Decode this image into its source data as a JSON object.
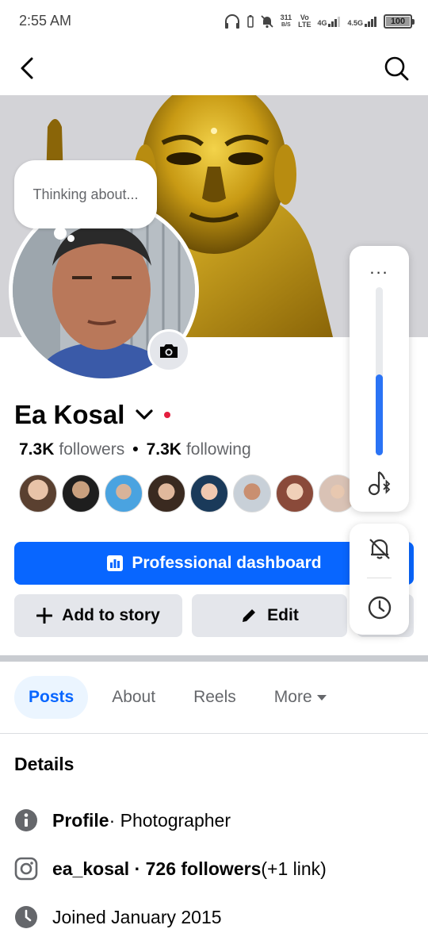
{
  "status_bar": {
    "time": "2:55 AM",
    "net_speed": "311",
    "net_unit": "B/S",
    "volte_top": "Vo",
    "volte_bottom": "LTE",
    "net_4g": "4G",
    "net_45g": "4.5G",
    "battery": "100"
  },
  "profile": {
    "name": "Ea Kosal",
    "thought_placeholder": "Thinking about...",
    "followers_count": "7.3K",
    "followers_label": "followers",
    "following_count": "7.3K",
    "following_label": "following",
    "separator": "•",
    "friends_preview_count": 8
  },
  "actions": {
    "dashboard_label": "Professional dashboard",
    "add_story_label": "Add to story",
    "edit_label": "Edit"
  },
  "tabs": [
    {
      "label": "Posts",
      "active": true
    },
    {
      "label": "About",
      "active": false
    },
    {
      "label": "Reels",
      "active": false
    },
    {
      "label": "More",
      "active": false
    }
  ],
  "details": {
    "title": "Details",
    "profile_label": "Profile",
    "profile_value": " · Photographer",
    "instagram_handle": "ea_kosal · 726 followers",
    "instagram_extra": " (+1 link)",
    "joined": "Joined January 2015"
  },
  "volume_panel": {
    "more_label": "...",
    "level_percent": 48,
    "accent_color": "#2a73f5"
  },
  "colors": {
    "primary": "#0866ff",
    "secondary_button": "#e4e6eb",
    "muted_text": "#65676b"
  }
}
